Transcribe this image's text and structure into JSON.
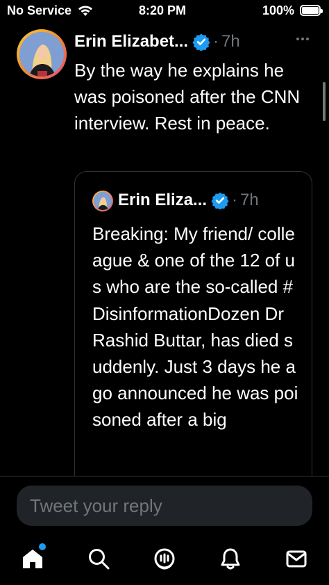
{
  "status_bar": {
    "carrier": "No Service",
    "time": "8:20 PM",
    "battery": "100%",
    "wifi_icon": "wifi-icon",
    "battery_icon": "battery-icon"
  },
  "tweet": {
    "author_name": "Erin Elizabet...",
    "verified_icon": "verified-badge-icon",
    "separator": "·",
    "time": "7h",
    "more_icon": "more-horizontal-icon",
    "text": "By the way he explains he was poisoned after the CNN interview. Rest in peace."
  },
  "quoted_tweet": {
    "author_name": "Erin Eliza...",
    "separator": "·",
    "time": "7h",
    "text": "Breaking: My friend/ colleague &  one of the 12 of us who are the so-called #DisinformationDozen Dr Rashid Buttar, has died suddenly. Just 3 days he ago announced  he was poisoned after a big"
  },
  "reply": {
    "placeholder": "Tweet your reply"
  },
  "tab_bar": {
    "items": [
      {
        "name": "home-icon"
      },
      {
        "name": "search-icon"
      },
      {
        "name": "spaces-icon"
      },
      {
        "name": "notifications-icon"
      },
      {
        "name": "messages-icon"
      }
    ]
  },
  "colors": {
    "background": "#000000",
    "text": "#ffffff",
    "secondary": "#71767b",
    "accent": "#1d9bf0",
    "border": "#2f3336"
  }
}
